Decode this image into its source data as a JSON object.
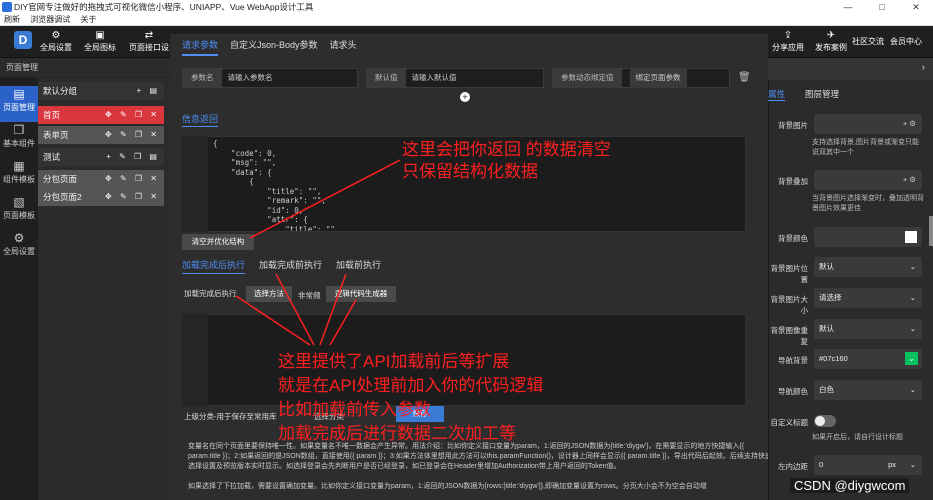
{
  "window": {
    "title": "DIY官网专注做好的拖拽式可视化微信小程序、UNIAPP、Vue WebApp设计工具",
    "controls": [
      "—",
      "□",
      "✕"
    ]
  },
  "menu": [
    "刷新",
    "浏览器调试",
    "关于"
  ],
  "toolbar": {
    "logo": "D",
    "left": [
      {
        "label": "全局设置",
        "icon": "gear-icon",
        "glyph": "⚙"
      },
      {
        "label": "全局图标",
        "icon": "image-icon",
        "glyph": "▣"
      },
      {
        "label": "页面接口设",
        "icon": "api-icon",
        "glyph": "⇄"
      }
    ],
    "right": [
      {
        "label": "分享应用",
        "icon": "share-icon",
        "glyph": "⇪"
      },
      {
        "label": "发布案例",
        "icon": "publish-icon",
        "glyph": "✈"
      },
      {
        "label": "社区交流",
        "icon": "chat-icon",
        "glyph": ""
      },
      {
        "label": "会员中心",
        "icon": "user-icon",
        "glyph": ""
      }
    ]
  },
  "left": {
    "header": "页面管理",
    "rail": [
      {
        "label": "页面管理",
        "glyph": "▤"
      },
      {
        "label": "基本组件",
        "glyph": "❒"
      },
      {
        "label": "组件模板",
        "glyph": "▦"
      },
      {
        "label": "页面模板",
        "glyph": "▧"
      },
      {
        "label": "全局设置",
        "glyph": "⚙"
      }
    ],
    "pages": [
      {
        "label": "默认分组",
        "acts": "+ ▤"
      },
      {
        "label": "首页",
        "acts": "✥ ✎ ❐ ✕"
      },
      {
        "label": "表单页",
        "acts": "✥ ✎ ❐ ✕"
      },
      {
        "label": "测试",
        "acts": "+ ✎ ❐ ▤"
      },
      {
        "label": "分包页面",
        "acts": "✥ ✎ ❐ ✕"
      },
      {
        "label": "分包页面2",
        "acts": "✥ ✎ ❐ ✕"
      }
    ]
  },
  "main": {
    "tabs": [
      "请求参数",
      "自定义Json-Body参数",
      "请求头"
    ],
    "params": [
      {
        "label": "参数名",
        "value": "请输入参数名"
      },
      {
        "label": "默认值",
        "value": "请输入默认值"
      },
      {
        "label": "参数动态绑定值",
        "value": "绑定页面参数"
      }
    ],
    "info_label": "信息返回",
    "code": "{\n    \"code\": 0,\n    \"msg\": \"\",\n    \"data\": {\n        {\n            \"title\": \"\",\n            \"remark\": \"\",\n            \"id\": 0,\n            \"attr\": {\n                \"title\": \"\"",
    "clear_button": "清空并优化结构",
    "exec_tabs": [
      "加载完成后执行",
      "加载完成前执行",
      "加载前执行"
    ],
    "exec_row": {
      "label": "加载完成后执行",
      "select_method": "选择方法",
      "hint": "非常频",
      "gen_button": "逻辑代码生成器"
    },
    "level_label": "上级分类-用于保存至常用库",
    "level_select": "选择分类",
    "level_button": "保存",
    "desc": "变量名在同个页面里要保持唯一性。如果变量名不唯一数据会产生异常。用法介绍：比如你定义接口变量为param，1:返回的JSON数据为{title:'diygw'}，在需要显示的地方快捷输入{{ param.title }}；2:如果返回的是JSON数组，直接使用{{ param }}；3:如果方法体里想用此方法可以this.paramFunction()，设计器上同样会显示{{ param.title }}，导出代码后起效。后续支持快速选择设置及预览版本实时显示。如选择登录会先判断用户是否已经登录，如已登录会在Header里增加Authorization带上用户返回的Token值。",
    "desc2": "如果选择了下拉加载，需要设置确加变量。比如你定义接口变量为param，1:返回的JSON数据为{rows:[title:'diygw']},即确加变量设置为rows。分页大小会不为空会自动增"
  },
  "annotations": [
    "这里会把你返回 的数据清空",
    "只保留结构化数据",
    "这里提供了API加载前后等扩展",
    "就是在API处理前加入你的代码逻辑",
    "比如加载前传入参数",
    "加载完成后进行数据二次加工等"
  ],
  "right": {
    "tabs": [
      "属性",
      "图层管理"
    ],
    "fields": [
      {
        "label": "背景图片",
        "hint": "支持选择背景,图片背景或渐变只能说双其中一个"
      },
      {
        "label": "背景叠加",
        "hint": "当背景图片选择渐变时，叠加透明背景图片效果更佳"
      }
    ],
    "rows": [
      {
        "label": "背景颜色",
        "value": ""
      },
      {
        "label": "背景图片位置",
        "value": "默认"
      },
      {
        "label": "背景图片大小",
        "value": "请选择"
      },
      {
        "label": "背景图像重复",
        "value": "默认"
      },
      {
        "label": "导航背景",
        "value": "#07c160"
      },
      {
        "label": "导航颜色",
        "value": "白色"
      }
    ],
    "custom_title": {
      "label": "自定义标题",
      "hint": "如果开启后，请自行设计标题"
    },
    "padding": {
      "label": "左内边距",
      "value": "0",
      "unit": "px"
    },
    "nav_color": "#07c160"
  },
  "watermark": "CSDN @diygwcom"
}
